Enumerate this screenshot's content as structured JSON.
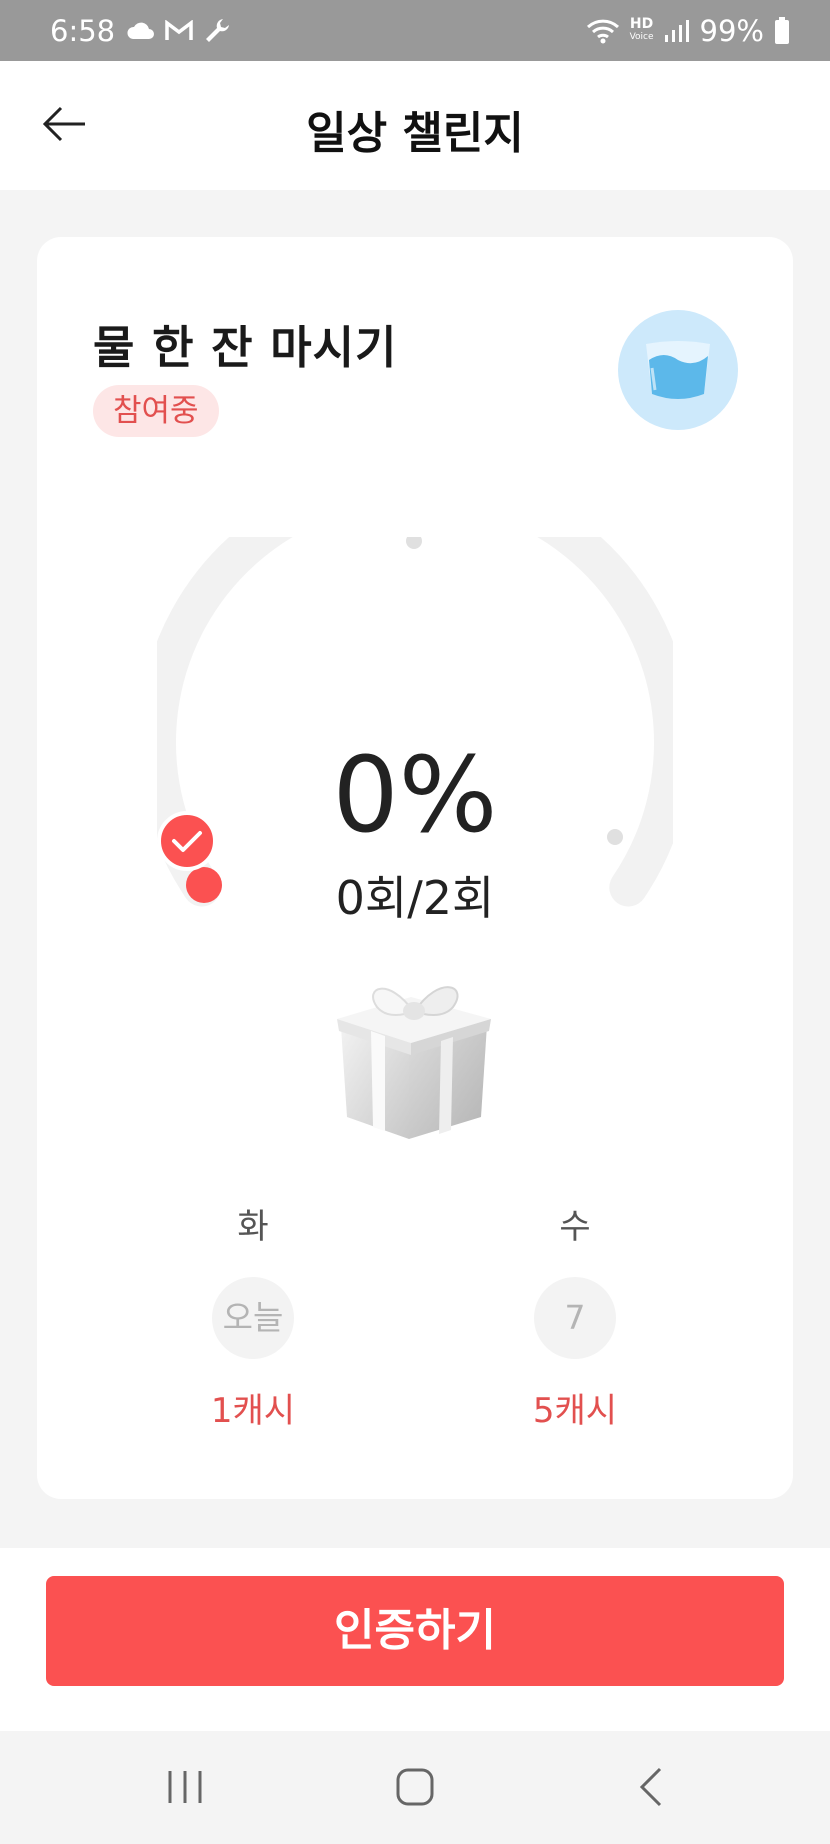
{
  "status_bar": {
    "time": "6:58",
    "left_icons": [
      "cloud-icon",
      "gmail-icon",
      "wrench-icon"
    ],
    "right_icons": [
      "wifi-icon",
      "hd-voice-icon",
      "signal-icon",
      "battery-icon"
    ],
    "hd_label": "HD",
    "voice_label": "Voice",
    "battery": "99%"
  },
  "app_bar": {
    "title": "일상 챌린지",
    "back_icon": "arrow-left-icon"
  },
  "challenge": {
    "title": "물 한 잔 마시기",
    "status": "참여중",
    "icon": "water-glass-icon",
    "progress_percent": 0,
    "percent_label": "0%",
    "count_label": "0회/2회",
    "reward_icon": "gift-box-icon"
  },
  "schedule": [
    {
      "day": "화",
      "date_label": "오늘",
      "reward": "1캐시"
    },
    {
      "day": "수",
      "date_label": "7",
      "reward": "5캐시"
    }
  ],
  "actions": {
    "verify_label": "인증하기"
  },
  "colors": {
    "accent": "#fb5151",
    "badge_bg": "#fde6e6",
    "badge_text": "#e2504f",
    "ring_track": "#f2f2f2"
  },
  "nav_bar": {
    "icons": [
      "recent-apps-icon",
      "home-icon",
      "back-icon"
    ]
  }
}
